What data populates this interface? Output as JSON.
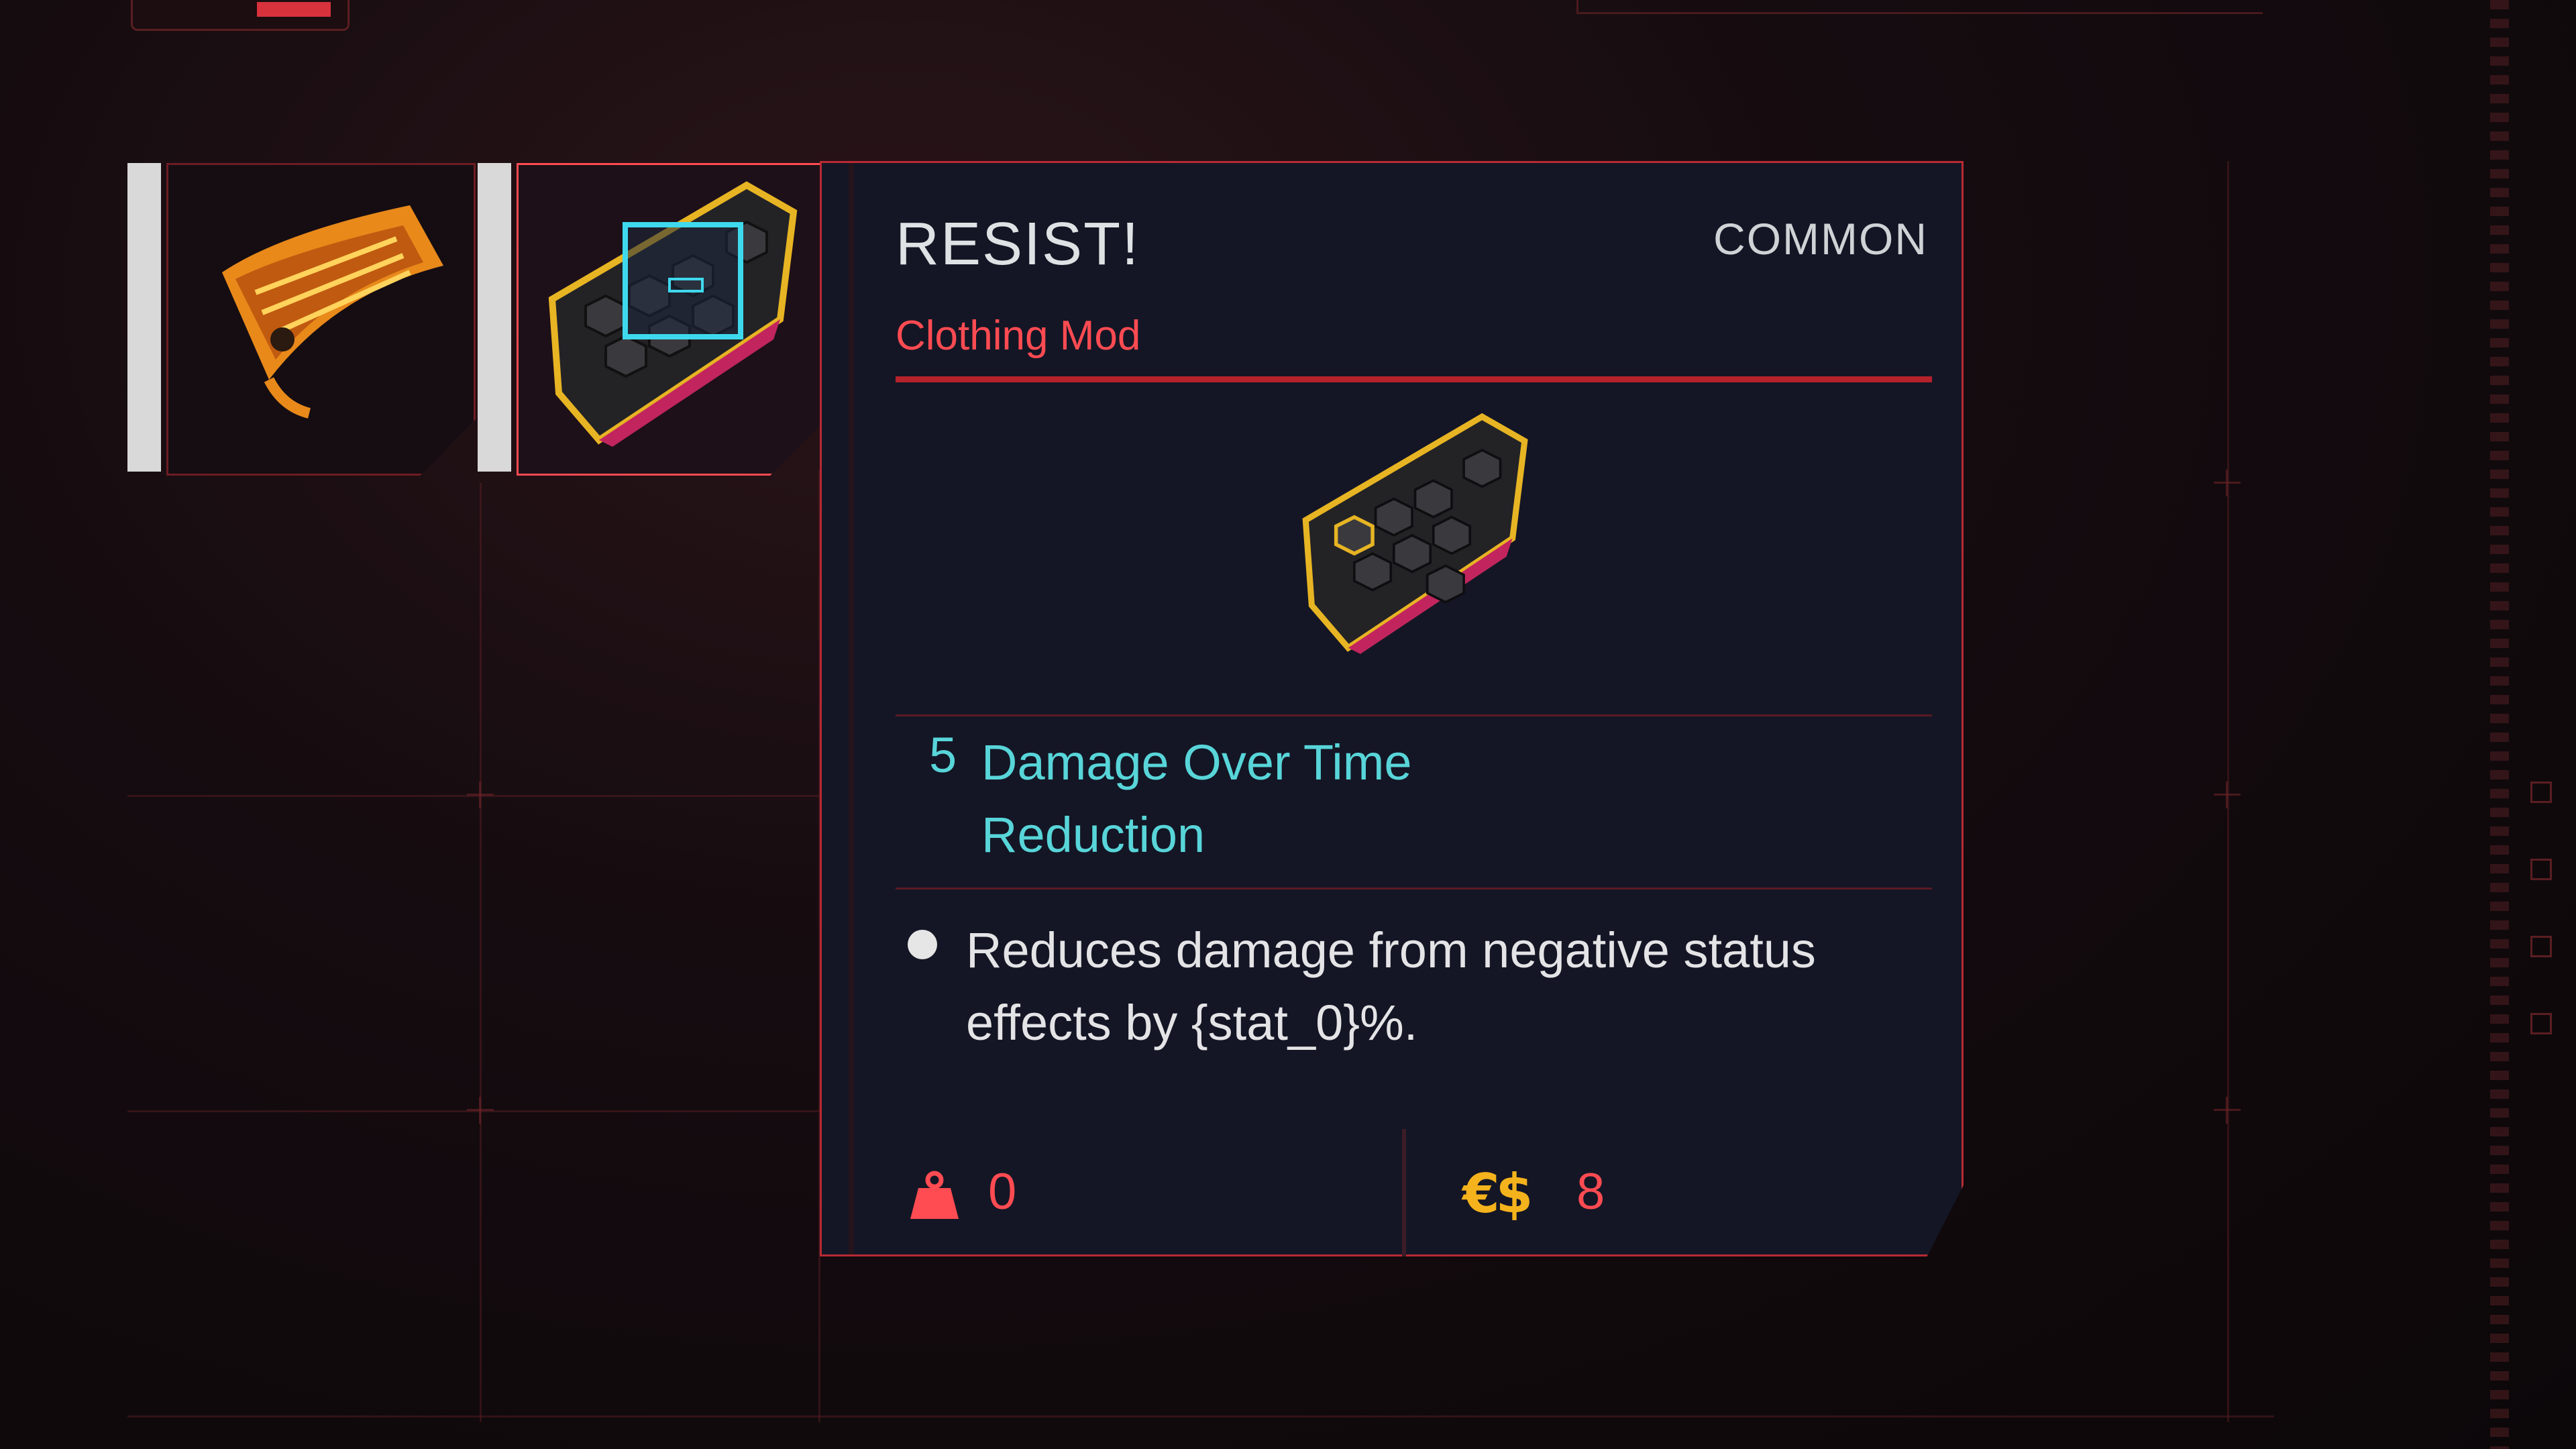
{
  "item": {
    "name": "RESIST!",
    "rarity": "COMMON",
    "type": "Clothing Mod",
    "stat": {
      "value": "5",
      "label": "Damage Over Time Reduction"
    },
    "description": "Reduces damage from negative status effects by {stat_0}%.",
    "weight": "0",
    "price_currency": "€$",
    "price": "8"
  },
  "icons": {
    "weight": "weight-icon",
    "currency": "eurodollar-icon",
    "bullet": "bullet-icon"
  },
  "colors": {
    "accent_red": "#ff4b52",
    "stat_cyan": "#58d5d9",
    "currency_gold": "#f4b21c",
    "panel_bg": "#141625"
  }
}
